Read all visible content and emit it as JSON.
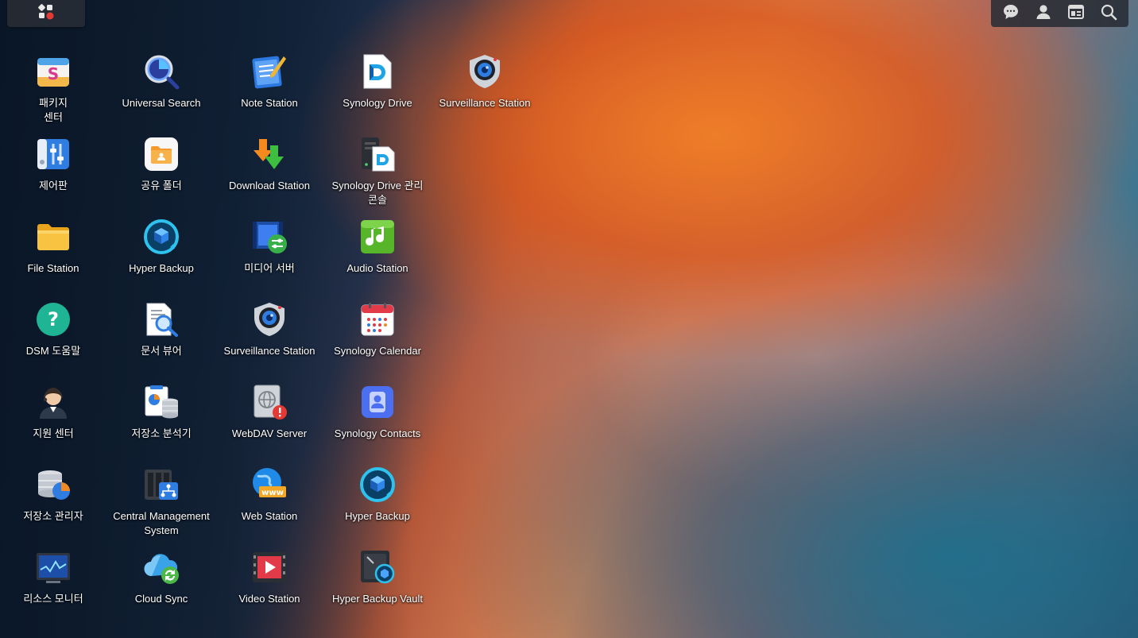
{
  "taskbar": {
    "main_menu_icon": "grid-with-notification-dot-icon",
    "tray": [
      {
        "name": "notifications",
        "icon": "chat-bubble-icon"
      },
      {
        "name": "user",
        "icon": "user-icon"
      },
      {
        "name": "widgets",
        "icon": "widget-panel-icon"
      },
      {
        "name": "search",
        "icon": "search-icon"
      }
    ]
  },
  "desktop": {
    "columns": [
      [
        {
          "label": "패키지\n센터",
          "icon": "package-center-icon"
        },
        {
          "label": "제어판",
          "icon": "control-panel-icon"
        },
        {
          "label": "File Station",
          "icon": "folder-icon"
        },
        {
          "label": "DSM 도움말",
          "icon": "help-icon"
        },
        {
          "label": "지원 센터",
          "icon": "support-center-icon"
        },
        {
          "label": "저장소 관리자",
          "icon": "storage-manager-icon"
        },
        {
          "label": "리소스 모니터",
          "icon": "resource-monitor-icon"
        }
      ],
      [
        {
          "label": "Universal Search",
          "icon": "universal-search-icon"
        },
        {
          "label": "공유 폴더",
          "icon": "shared-folder-icon"
        },
        {
          "label": "Hyper Backup",
          "icon": "hyper-backup-icon"
        },
        {
          "label": "문서 뷰어",
          "icon": "document-viewer-icon"
        },
        {
          "label": "저장소 분석기",
          "icon": "storage-analyzer-icon"
        },
        {
          "label": "Central Management\nSystem",
          "icon": "central-management-icon"
        },
        {
          "label": "Cloud Sync",
          "icon": "cloud-sync-icon"
        }
      ],
      [
        {
          "label": "Note Station",
          "icon": "note-station-icon"
        },
        {
          "label": "Download Station",
          "icon": "download-station-icon"
        },
        {
          "label": "미디어 서버",
          "icon": "media-server-icon"
        },
        {
          "label": "Surveillance Station",
          "icon": "surveillance-camera-icon"
        },
        {
          "label": "WebDAV Server",
          "icon": "webdav-server-icon"
        },
        {
          "label": "Web Station",
          "icon": "web-station-icon"
        },
        {
          "label": "Video Station",
          "icon": "video-station-icon"
        }
      ],
      [
        {
          "label": "Synology Drive",
          "icon": "synology-drive-icon"
        },
        {
          "label": "Synology Drive 관리\n콘솔",
          "icon": "drive-admin-console-icon"
        },
        {
          "label": "Audio Station",
          "icon": "audio-station-icon"
        },
        {
          "label": "Synology Calendar",
          "icon": "calendar-icon"
        },
        {
          "label": "Synology Contacts",
          "icon": "contacts-icon"
        },
        {
          "label": "Hyper Backup",
          "icon": "hyper-backup-icon"
        },
        {
          "label": "Hyper Backup Vault",
          "icon": "hyper-backup-vault-icon"
        }
      ],
      [
        {
          "label": "Surveillance Station",
          "icon": "surveillance-camera-icon"
        }
      ]
    ]
  }
}
